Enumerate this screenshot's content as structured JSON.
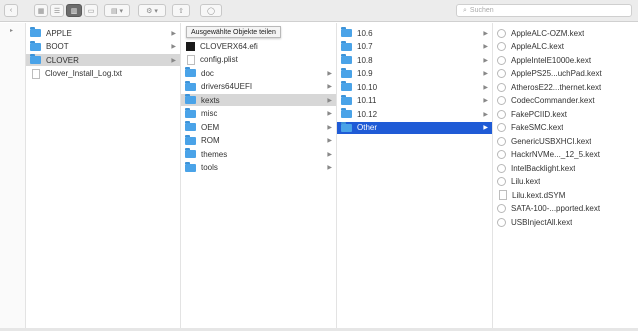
{
  "toolbar": {
    "search_placeholder": "Suchen"
  },
  "columns": {
    "c1": [
      {
        "label": "APPLE",
        "kind": "folder",
        "arrow": true
      },
      {
        "label": "BOOT",
        "kind": "folder",
        "arrow": true
      },
      {
        "label": "CLOVER",
        "kind": "folder",
        "arrow": true,
        "selected": "gray"
      },
      {
        "label": "Clover_Install_Log.txt",
        "kind": "doc",
        "arrow": false
      }
    ],
    "c2": [
      {
        "label": "CLOVERX64.efi",
        "kind": "exe",
        "arrow": false
      },
      {
        "label": "config.plist",
        "kind": "doc",
        "arrow": false
      },
      {
        "label": "doc",
        "kind": "folder",
        "arrow": true
      },
      {
        "label": "drivers64UEFI",
        "kind": "folder",
        "arrow": true
      },
      {
        "label": "kexts",
        "kind": "folder",
        "arrow": true,
        "selected": "gray"
      },
      {
        "label": "misc",
        "kind": "folder",
        "arrow": true
      },
      {
        "label": "OEM",
        "kind": "folder",
        "arrow": true
      },
      {
        "label": "ROM",
        "kind": "folder",
        "arrow": true
      },
      {
        "label": "themes",
        "kind": "folder",
        "arrow": true
      },
      {
        "label": "tools",
        "kind": "folder",
        "arrow": true
      }
    ],
    "c3": [
      {
        "label": "10.6",
        "kind": "folder",
        "arrow": true
      },
      {
        "label": "10.7",
        "kind": "folder",
        "arrow": true
      },
      {
        "label": "10.8",
        "kind": "folder",
        "arrow": true
      },
      {
        "label": "10.9",
        "kind": "folder",
        "arrow": true
      },
      {
        "label": "10.10",
        "kind": "folder",
        "arrow": true
      },
      {
        "label": "10.11",
        "kind": "folder",
        "arrow": true
      },
      {
        "label": "10.12",
        "kind": "folder",
        "arrow": true
      },
      {
        "label": "Other",
        "kind": "folder",
        "arrow": true,
        "selected": "blue"
      }
    ],
    "c4": [
      {
        "label": "AppleALC-OZM.kext",
        "kind": "kext"
      },
      {
        "label": "AppleALC.kext",
        "kind": "kext"
      },
      {
        "label": "AppleIntelE1000e.kext",
        "kind": "kext"
      },
      {
        "label": "ApplePS25...uchPad.kext",
        "kind": "kext"
      },
      {
        "label": "AtherosE22...thernet.kext",
        "kind": "kext"
      },
      {
        "label": "CodecCommander.kext",
        "kind": "kext"
      },
      {
        "label": "FakePCIID.kext",
        "kind": "kext"
      },
      {
        "label": "FakeSMC.kext",
        "kind": "kext"
      },
      {
        "label": "GenericUSBXHCI.kext",
        "kind": "kext"
      },
      {
        "label": "HackrNVMe..._12_5.kext",
        "kind": "kext"
      },
      {
        "label": "IntelBacklight.kext",
        "kind": "kext"
      },
      {
        "label": "Lilu.kext",
        "kind": "kext"
      },
      {
        "label": "Lilu.kext.dSYM",
        "kind": "doc"
      },
      {
        "label": "SATA-100-...pported.kext",
        "kind": "kext"
      },
      {
        "label": "USBInjectAll.kext",
        "kind": "kext"
      }
    ]
  },
  "tooltip": "Ausgewählte Objekte teilen",
  "colors": {
    "folder": "#4aa3e8",
    "selection_blue": "#1f5bd6",
    "selection_gray": "#d7d7d7"
  }
}
